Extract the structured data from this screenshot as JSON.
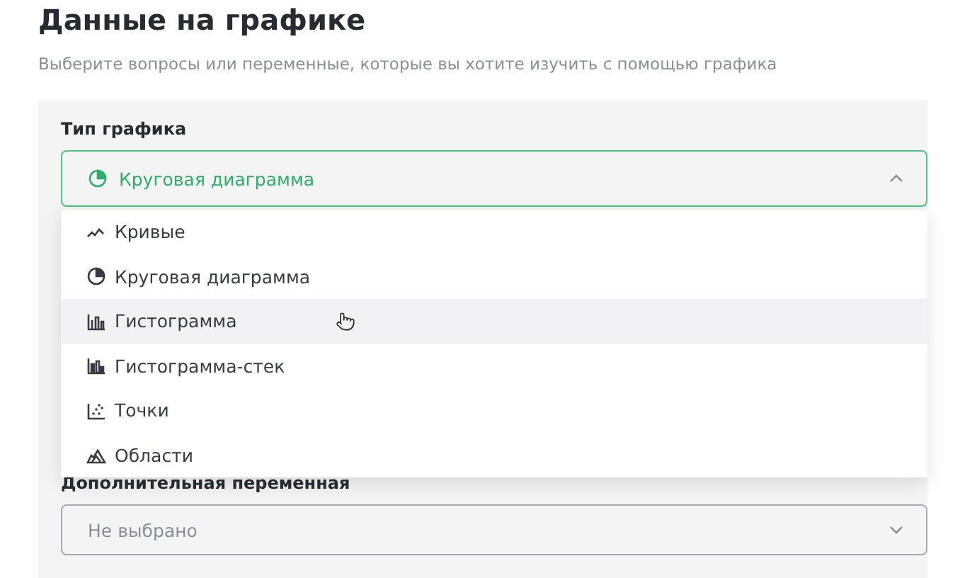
{
  "heading": "Данные на графике",
  "subtitle": "Выберите вопросы или переменные, которые вы хотите изучить с помощью графика",
  "chart_type": {
    "label": "Тип графика",
    "value": {
      "label": "Круговая диаграмма",
      "kind": "pie"
    },
    "expanded": true,
    "options": [
      {
        "label": "Кривые",
        "kind": "line",
        "highlighted": false
      },
      {
        "label": "Круговая диаграмма",
        "kind": "pie",
        "highlighted": false
      },
      {
        "label": "Гистограмма",
        "kind": "bar",
        "highlighted": true
      },
      {
        "label": "Гистограмма-стек",
        "kind": "stacked",
        "highlighted": false
      },
      {
        "label": "Точки",
        "kind": "scatter",
        "highlighted": false
      },
      {
        "label": "Области",
        "kind": "area",
        "highlighted": false
      }
    ]
  },
  "extra_variable": {
    "label": "Дополнительная переменная",
    "placeholder": "Не выбрано",
    "expanded": false
  }
}
